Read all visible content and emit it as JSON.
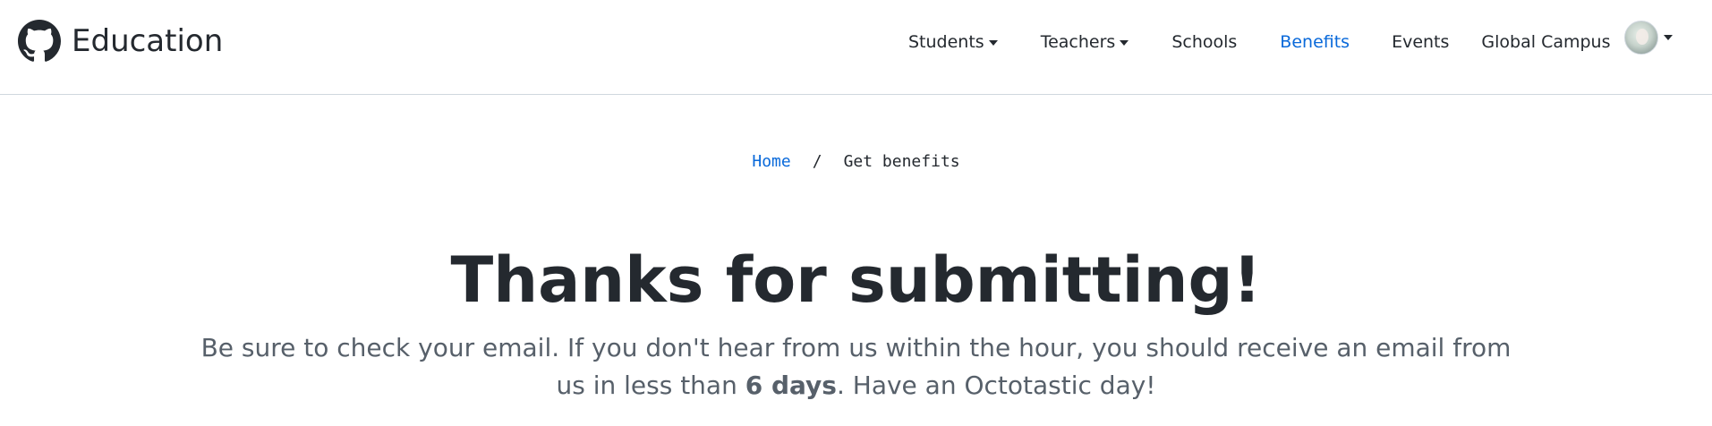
{
  "header": {
    "brand_label": "Education",
    "nav": [
      {
        "label": "Students",
        "has_dropdown": true
      },
      {
        "label": "Teachers",
        "has_dropdown": true
      },
      {
        "label": "Schools",
        "has_dropdown": false
      },
      {
        "label": "Benefits",
        "has_dropdown": false,
        "active": true
      },
      {
        "label": "Events",
        "has_dropdown": false
      },
      {
        "label": "Global Campus",
        "has_dropdown": false
      }
    ],
    "icons": {
      "brand": "github-octocat-icon",
      "avatar": "user-avatar",
      "dropdown": "caret-down-icon"
    }
  },
  "breadcrumb": {
    "home": "Home",
    "separator": "/",
    "current": "Get benefits"
  },
  "main": {
    "title": "Thanks for submitting!",
    "message_before": "Be sure to check your email. If you don't hear from us within the hour, you should receive an email from us in less than ",
    "message_bold": "6 days",
    "message_after": ". Have an Octotastic day!"
  },
  "colors": {
    "text": "#24292f",
    "muted": "#57606a",
    "link": "#0969da",
    "border": "#d0d7de"
  }
}
